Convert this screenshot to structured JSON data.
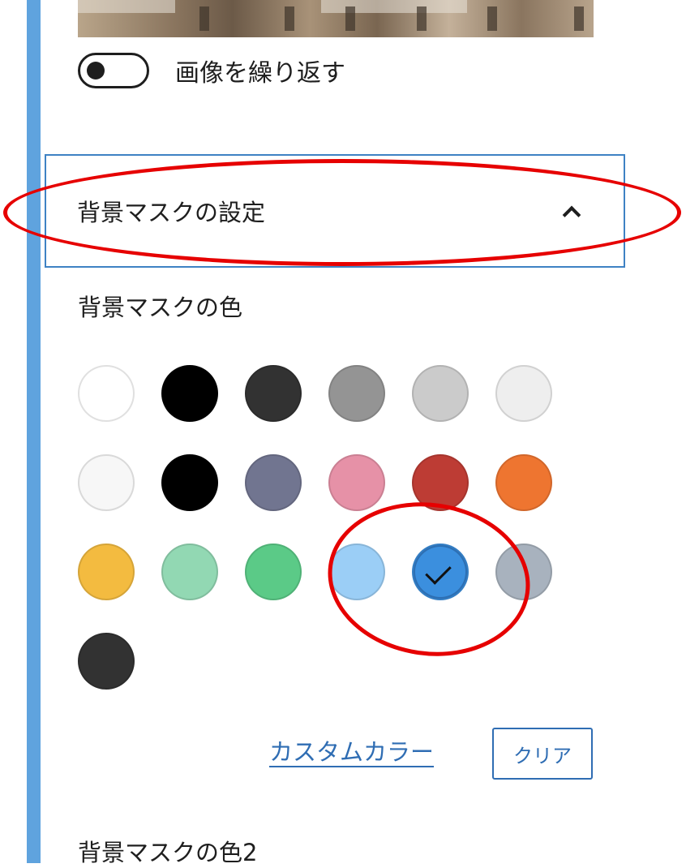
{
  "toggle": {
    "label": "画像を繰り返す",
    "state": "off"
  },
  "panel": {
    "title": "背景マスクの設定",
    "expanded": true,
    "chevron_icon": "chevron-up-icon"
  },
  "color_section": {
    "label": "背景マスクの色"
  },
  "palette": {
    "colors": [
      "#ffffff",
      "#000000",
      "#323232",
      "#949494",
      "#cbcbcb",
      "#eeeeee",
      "#f7f7f7",
      "#000000",
      "#717590",
      "#e691a7",
      "#bd3c34",
      "#ee7530",
      "#f3bb40",
      "#92d8b3",
      "#5bca87",
      "#9bcef6",
      "#3b8fde",
      "#a8b2be",
      "#323232"
    ],
    "selected_color": "#3b8fde"
  },
  "actions": {
    "custom_color_label": "カスタムカラー",
    "clear_label": "クリア"
  },
  "next_section": {
    "label": "背景マスクの色2"
  },
  "colors": {
    "accent": "#2f6db3",
    "sidebar": "#5fa3de",
    "annotation": "#e60000"
  }
}
